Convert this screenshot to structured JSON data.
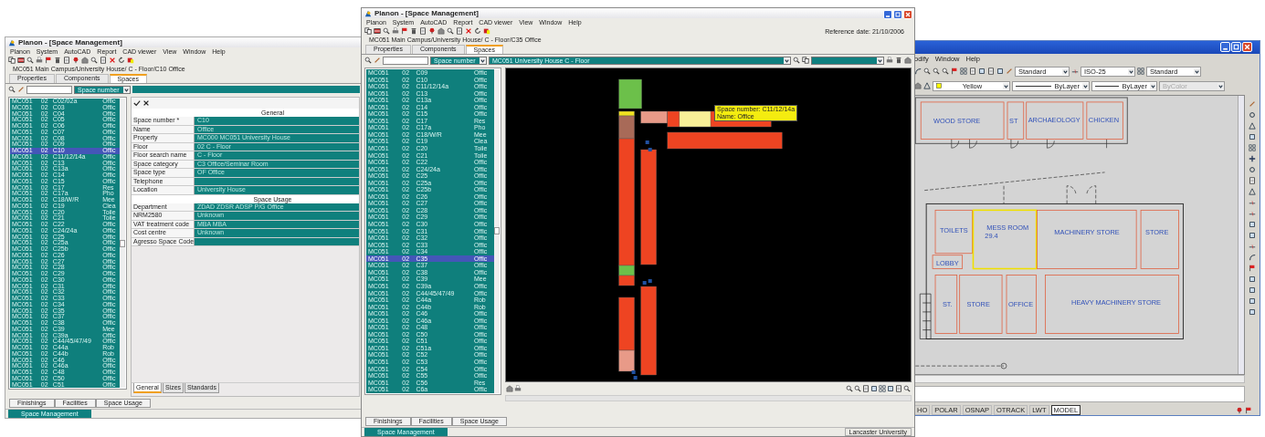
{
  "planon_left": {
    "title": "Planon - [Space Management]",
    "menu": [
      "Planon",
      "System",
      "AutoCAD",
      "Report",
      "CAD viewer",
      "View",
      "Window",
      "Help"
    ],
    "path": "MC051  Main Campus/University House/ C - Floor/C10 Office",
    "tabs": [
      {
        "label": "Properties",
        "selected": false
      },
      {
        "label": "Components",
        "selected": false
      },
      {
        "label": "Spaces",
        "selected": true
      }
    ],
    "space_filter": "Space number",
    "list": [
      {
        "site": "MC051",
        "floor": "02",
        "space": "C02/02a",
        "use": "Offic",
        "selected": false
      },
      {
        "site": "MC051",
        "floor": "02",
        "space": "C03",
        "use": "Offic",
        "selected": false
      },
      {
        "site": "MC051",
        "floor": "02",
        "space": "C04",
        "use": "Offic",
        "selected": false
      },
      {
        "site": "MC051",
        "floor": "02",
        "space": "C05",
        "use": "Offic",
        "selected": false
      },
      {
        "site": "MC051",
        "floor": "02",
        "space": "C06",
        "use": "Offic",
        "selected": false
      },
      {
        "site": "MC051",
        "floor": "02",
        "space": "C07",
        "use": "Offic",
        "selected": false
      },
      {
        "site": "MC051",
        "floor": "02",
        "space": "C08",
        "use": "Offic",
        "selected": false
      },
      {
        "site": "MC051",
        "floor": "02",
        "space": "C09",
        "use": "Offic",
        "selected": false
      },
      {
        "site": "MC051",
        "floor": "02",
        "space": "C10",
        "use": "Offic",
        "selected": true
      },
      {
        "site": "MC051",
        "floor": "02",
        "space": "C11/12/14a",
        "use": "Offic",
        "selected": false
      },
      {
        "site": "MC051",
        "floor": "02",
        "space": "C13",
        "use": "Offic",
        "selected": false
      },
      {
        "site": "MC051",
        "floor": "02",
        "space": "C13a",
        "use": "Offic",
        "selected": false
      },
      {
        "site": "MC051",
        "floor": "02",
        "space": "C14",
        "use": "Offic",
        "selected": false
      },
      {
        "site": "MC051",
        "floor": "02",
        "space": "C15",
        "use": "Offic",
        "selected": false
      },
      {
        "site": "MC051",
        "floor": "02",
        "space": "C17",
        "use": "Res",
        "selected": false
      },
      {
        "site": "MC051",
        "floor": "02",
        "space": "C17a",
        "use": "Pho",
        "selected": false
      },
      {
        "site": "MC051",
        "floor": "02",
        "space": "C18/W/R",
        "use": "Mee",
        "selected": false
      },
      {
        "site": "MC051",
        "floor": "02",
        "space": "C19",
        "use": "Clea",
        "selected": false
      },
      {
        "site": "MC051",
        "floor": "02",
        "space": "C20",
        "use": "Toile",
        "selected": false
      },
      {
        "site": "MC051",
        "floor": "02",
        "space": "C21",
        "use": "Toile",
        "selected": false
      },
      {
        "site": "MC051",
        "floor": "02",
        "space": "C22",
        "use": "Offic",
        "selected": false
      },
      {
        "site": "MC051",
        "floor": "02",
        "space": "C24/24a",
        "use": "Offic",
        "selected": false
      },
      {
        "site": "MC051",
        "floor": "02",
        "space": "C25",
        "use": "Offic",
        "selected": false
      },
      {
        "site": "MC051",
        "floor": "02",
        "space": "C25a",
        "use": "Offic",
        "selected": false
      },
      {
        "site": "MC051",
        "floor": "02",
        "space": "C25b",
        "use": "Offic",
        "selected": false
      },
      {
        "site": "MC051",
        "floor": "02",
        "space": "C26",
        "use": "Offic",
        "selected": false
      },
      {
        "site": "MC051",
        "floor": "02",
        "space": "C27",
        "use": "Offic",
        "selected": false
      },
      {
        "site": "MC051",
        "floor": "02",
        "space": "C28",
        "use": "Offic",
        "selected": false
      },
      {
        "site": "MC051",
        "floor": "02",
        "space": "C29",
        "use": "Offic",
        "selected": false
      },
      {
        "site": "MC051",
        "floor": "02",
        "space": "C30",
        "use": "Offic",
        "selected": false
      },
      {
        "site": "MC051",
        "floor": "02",
        "space": "C31",
        "use": "Offic",
        "selected": false
      },
      {
        "site": "MC051",
        "floor": "02",
        "space": "C32",
        "use": "Offic",
        "selected": false
      },
      {
        "site": "MC051",
        "floor": "02",
        "space": "C33",
        "use": "Offic",
        "selected": false
      },
      {
        "site": "MC051",
        "floor": "02",
        "space": "C34",
        "use": "Offic",
        "selected": false
      },
      {
        "site": "MC051",
        "floor": "02",
        "space": "C35",
        "use": "Offic",
        "selected": false
      },
      {
        "site": "MC051",
        "floor": "02",
        "space": "C37",
        "use": "Offic",
        "selected": false
      },
      {
        "site": "MC051",
        "floor": "02",
        "space": "C38",
        "use": "Offic",
        "selected": false
      },
      {
        "site": "MC051",
        "floor": "02",
        "space": "C39",
        "use": "Mee",
        "selected": false
      },
      {
        "site": "MC051",
        "floor": "02",
        "space": "C39a",
        "use": "Offic",
        "selected": false
      },
      {
        "site": "MC051",
        "floor": "02",
        "space": "C44/45/47/49",
        "use": "Offic",
        "selected": false
      },
      {
        "site": "MC051",
        "floor": "02",
        "space": "C44a",
        "use": "Rob",
        "selected": false
      },
      {
        "site": "MC051",
        "floor": "02",
        "space": "C44b",
        "use": "Rob",
        "selected": false
      },
      {
        "site": "MC051",
        "floor": "02",
        "space": "C46",
        "use": "Offic",
        "selected": false
      },
      {
        "site": "MC051",
        "floor": "02",
        "space": "C46a",
        "use": "Offic",
        "selected": false
      },
      {
        "site": "MC051",
        "floor": "02",
        "space": "C48",
        "use": "Offic",
        "selected": false
      },
      {
        "site": "MC051",
        "floor": "02",
        "space": "C50",
        "use": "Offic",
        "selected": false
      },
      {
        "site": "MC051",
        "floor": "02",
        "space": "C51",
        "use": "Offic",
        "selected": false
      }
    ],
    "form": {
      "header": "General",
      "fields": [
        {
          "label": "Space number *",
          "value": "C10"
        },
        {
          "label": "Name",
          "value": "Office"
        },
        {
          "label": "Property",
          "value": "MC000 MC051 University House"
        },
        {
          "label": "Floor",
          "value": "02  C - Floor"
        },
        {
          "label": "Floor search name",
          "value": "C - Floor"
        },
        {
          "label": "Space category",
          "value": "C3  Office/Seminar Room"
        },
        {
          "label": "Space type",
          "value": "OF  Office"
        },
        {
          "label": "Telephone"
        },
        {
          "label": "Location",
          "value": "University House"
        }
      ],
      "section": "Space Usage",
      "usage_fields": [
        {
          "label": "Department",
          "value": "ZDAD ZDSR ADSP P/G Office"
        },
        {
          "label": "NRM2580",
          "value": "Unknown"
        },
        {
          "label": "VAT treatment code",
          "value": "MBA  MBA"
        },
        {
          "label": "Cost centre",
          "value": "Unknown"
        },
        {
          "label": "Agresso Space Code"
        }
      ],
      "tabs": [
        {
          "label": "General",
          "selected": true
        },
        {
          "label": "Sizes",
          "selected": false
        },
        {
          "label": "Standards",
          "selected": false
        }
      ]
    },
    "bottom_tabs": [
      "Finishings",
      "Facilities",
      "Space Usage"
    ],
    "taskbar": "Space Management"
  },
  "planon_middle": {
    "title": "Planon - [Space Management]",
    "menu": [
      "Planon",
      "System",
      "AutoCAD",
      "Report",
      "CAD viewer",
      "View",
      "Window",
      "Help"
    ],
    "reference_date": "Reference date: 21/10/2006",
    "path": "MC051  Main Campus/University House/ C - Floor/C35 Office",
    "tabs": [
      {
        "label": "Properties",
        "selected": false
      },
      {
        "label": "Components",
        "selected": false
      },
      {
        "label": "Spaces",
        "selected": true
      }
    ],
    "space_filter": "Space number",
    "floor_filter": "MC051  University House  C - Floor",
    "list": [
      {
        "site": "MC051",
        "floor": "02",
        "space": "C09",
        "use": "Offic",
        "selected": false
      },
      {
        "site": "MC051",
        "floor": "02",
        "space": "C10",
        "use": "Offic",
        "selected": false
      },
      {
        "site": "MC051",
        "floor": "02",
        "space": "C11/12/14a",
        "use": "Offic",
        "selected": false
      },
      {
        "site": "MC051",
        "floor": "02",
        "space": "C13",
        "use": "Offic",
        "selected": false
      },
      {
        "site": "MC051",
        "floor": "02",
        "space": "C13a",
        "use": "Offic",
        "selected": false
      },
      {
        "site": "MC051",
        "floor": "02",
        "space": "C14",
        "use": "Offic",
        "selected": false
      },
      {
        "site": "MC051",
        "floor": "02",
        "space": "C15",
        "use": "Offic",
        "selected": false
      },
      {
        "site": "MC051",
        "floor": "02",
        "space": "C17",
        "use": "Res",
        "selected": false
      },
      {
        "site": "MC051",
        "floor": "02",
        "space": "C17a",
        "use": "Pho",
        "selected": false
      },
      {
        "site": "MC051",
        "floor": "02",
        "space": "C18/W/R",
        "use": "Mee",
        "selected": false
      },
      {
        "site": "MC051",
        "floor": "02",
        "space": "C19",
        "use": "Clea",
        "selected": false
      },
      {
        "site": "MC051",
        "floor": "02",
        "space": "C20",
        "use": "Toile",
        "selected": false
      },
      {
        "site": "MC051",
        "floor": "02",
        "space": "C21",
        "use": "Toile",
        "selected": false
      },
      {
        "site": "MC051",
        "floor": "02",
        "space": "C22",
        "use": "Offic",
        "selected": false
      },
      {
        "site": "MC051",
        "floor": "02",
        "space": "C24/24a",
        "use": "Offic",
        "selected": false
      },
      {
        "site": "MC051",
        "floor": "02",
        "space": "C25",
        "use": "Offic",
        "selected": false
      },
      {
        "site": "MC051",
        "floor": "02",
        "space": "C25a",
        "use": "Offic",
        "selected": false
      },
      {
        "site": "MC051",
        "floor": "02",
        "space": "C25b",
        "use": "Offic",
        "selected": false
      },
      {
        "site": "MC051",
        "floor": "02",
        "space": "C26",
        "use": "Offic",
        "selected": false
      },
      {
        "site": "MC051",
        "floor": "02",
        "space": "C27",
        "use": "Offic",
        "selected": false
      },
      {
        "site": "MC051",
        "floor": "02",
        "space": "C28",
        "use": "Offic",
        "selected": false
      },
      {
        "site": "MC051",
        "floor": "02",
        "space": "C29",
        "use": "Offic",
        "selected": false
      },
      {
        "site": "MC051",
        "floor": "02",
        "space": "C30",
        "use": "Offic",
        "selected": false
      },
      {
        "site": "MC051",
        "floor": "02",
        "space": "C31",
        "use": "Offic",
        "selected": false
      },
      {
        "site": "MC051",
        "floor": "02",
        "space": "C32",
        "use": "Offic",
        "selected": false
      },
      {
        "site": "MC051",
        "floor": "02",
        "space": "C33",
        "use": "Offic",
        "selected": false
      },
      {
        "site": "MC051",
        "floor": "02",
        "space": "C34",
        "use": "Offic",
        "selected": false
      },
      {
        "site": "MC051",
        "floor": "02",
        "space": "C35",
        "use": "Offic",
        "selected": true
      },
      {
        "site": "MC051",
        "floor": "02",
        "space": "C37",
        "use": "Offic",
        "selected": false
      },
      {
        "site": "MC051",
        "floor": "02",
        "space": "C38",
        "use": "Offic",
        "selected": false
      },
      {
        "site": "MC051",
        "floor": "02",
        "space": "C39",
        "use": "Mee",
        "selected": false
      },
      {
        "site": "MC051",
        "floor": "02",
        "space": "C39a",
        "use": "Offic",
        "selected": false
      },
      {
        "site": "MC051",
        "floor": "02",
        "space": "C44/45/47/49",
        "use": "Offic",
        "selected": false
      },
      {
        "site": "MC051",
        "floor": "02",
        "space": "C44a",
        "use": "Rob",
        "selected": false
      },
      {
        "site": "MC051",
        "floor": "02",
        "space": "C44b",
        "use": "Rob",
        "selected": false
      },
      {
        "site": "MC051",
        "floor": "02",
        "space": "C46",
        "use": "Offic",
        "selected": false
      },
      {
        "site": "MC051",
        "floor": "02",
        "space": "C46a",
        "use": "Offic",
        "selected": false
      },
      {
        "site": "MC051",
        "floor": "02",
        "space": "C48",
        "use": "Offic",
        "selected": false
      },
      {
        "site": "MC051",
        "floor": "02",
        "space": "C50",
        "use": "Offic",
        "selected": false
      },
      {
        "site": "MC051",
        "floor": "02",
        "space": "C51",
        "use": "Offic",
        "selected": false
      },
      {
        "site": "MC051",
        "floor": "02",
        "space": "C51a",
        "use": "Offic",
        "selected": false
      },
      {
        "site": "MC051",
        "floor": "02",
        "space": "C52",
        "use": "Offic",
        "selected": false
      },
      {
        "site": "MC051",
        "floor": "02",
        "space": "C53",
        "use": "Offic",
        "selected": false
      },
      {
        "site": "MC051",
        "floor": "02",
        "space": "C54",
        "use": "Offic",
        "selected": false
      },
      {
        "site": "MC051",
        "floor": "02",
        "space": "C55",
        "use": "Offic",
        "selected": false
      },
      {
        "site": "MC051",
        "floor": "02",
        "space": "C56",
        "use": "Res",
        "selected": false
      },
      {
        "site": "MC051",
        "floor": "02",
        "space": "C6a",
        "use": "Offic",
        "selected": false
      }
    ],
    "plan_tooltip": [
      "Space number: C11/12/14a",
      "Name: Office"
    ],
    "bottom_tabs": [
      "Finishings",
      "Facilities",
      "Space Usage"
    ],
    "taskbar": "Space Management",
    "status": "Lancaster University"
  },
  "cad": {
    "menu": [
      "odify",
      "Window",
      "Help"
    ],
    "styles": [
      "Standard",
      "ISO-25",
      "Standard"
    ],
    "layer": "Yellow",
    "linetype": "ByLayer",
    "lineweight": "ByLayer",
    "plot_style": {
      "label": "ByColor",
      "disabled": true
    },
    "rooms": [
      {
        "label": "WOOD STORE",
        "selected": false
      },
      {
        "label": "ST",
        "selected": false
      },
      {
        "label": "ARCHAEOLOGY",
        "selected": false
      },
      {
        "label": "CHICKEN",
        "selected": false
      },
      {
        "label": "TOILETS",
        "selected": false
      },
      {
        "label": "MESS ROOM",
        "area": "29.4",
        "selected": true
      },
      {
        "label": "LOBBY",
        "selected": false
      },
      {
        "label": "MACHINERY STORE",
        "selected": false
      },
      {
        "label": "STORE",
        "selected": false
      },
      {
        "label": "ST.",
        "selected": false
      },
      {
        "label": "STORE",
        "selected": false
      },
      {
        "label": "OFFICE",
        "selected": false
      },
      {
        "label": "HEAVY MACHINERY STORE",
        "selected": false
      }
    ],
    "status_buttons": [
      {
        "label": "HO",
        "on": false
      },
      {
        "label": "POLAR",
        "on": false
      },
      {
        "label": "OSNAP",
        "on": false
      },
      {
        "label": "OTRACK",
        "on": false
      },
      {
        "label": "LWT",
        "on": false
      },
      {
        "label": "MODEL",
        "on": true
      }
    ]
  }
}
